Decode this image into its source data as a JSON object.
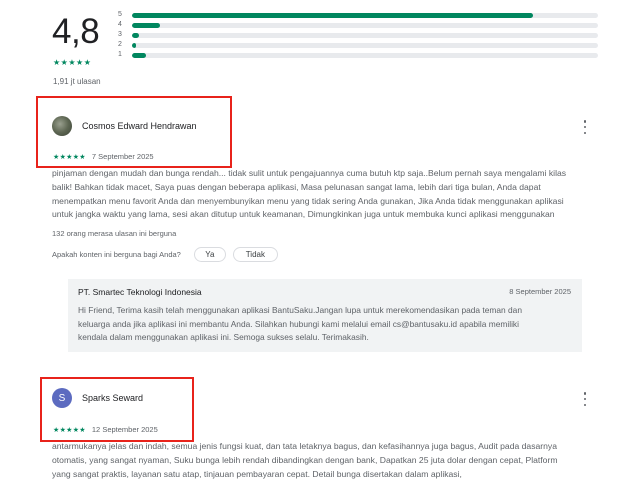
{
  "rating_summary": {
    "average": "4,8",
    "stars": "★★★★★",
    "review_count": "1,91 jt ulasan",
    "distribution": [
      {
        "label": "5",
        "fraction": 0.86
      },
      {
        "label": "4",
        "fraction": 0.06
      },
      {
        "label": "3",
        "fraction": 0.015
      },
      {
        "label": "2",
        "fraction": 0.008
      },
      {
        "label": "1",
        "fraction": 0.03
      }
    ],
    "accent_color": "#01875f"
  },
  "reviews": [
    {
      "name": "Cosmos Edward Hendrawan",
      "stars": "★★★★★",
      "date": "7 September 2025",
      "lines": [
        "pinjaman dengan mudah dan bunga rendah... tidak sulit untuk pengajuannya cuma butuh ktp saja..Belum pernah saya mengalami kilas",
        "balik! Bahkan tidak macet, Saya puas dengan beberapa aplikasi, Masa pelunasan sangat lama, lebih dari tiga bulan, Anda dapat",
        "menempatkan menu favorit Anda dan menyembunyikan menu yang tidak sering Anda gunakan, Jika Anda tidak menggunakan aplikasi",
        "untuk jangka waktu yang lama, sesi akan ditutup untuk keamanan, Dimungkinkan juga untuk membuka kunci aplikasi menggunakan"
      ],
      "helpful_count": "132 orang merasa ulasan ini berguna",
      "helpful_question": "Apakah konten ini berguna bagi Anda?",
      "yes_label": "Ya",
      "no_label": "Tidak",
      "developer_reply": {
        "name": "PT. Smartec Teknologi Indonesia",
        "date": "8 September 2025",
        "lines": [
          "Hi Friend, Terima kasih telah menggunakan aplikasi BantuSaku.Jangan lupa untuk merekomendasikan pada teman dan",
          "keluarga anda jika aplikasi ini membantu Anda. Silahkan hubungi kami melalui email cs@bantusaku.id apabila memiliki",
          "kendala dalam menggunakan aplikasi ini. Semoga sukses selalu. Terimakasih."
        ]
      }
    },
    {
      "name": "Sparks Seward",
      "avatar_letter": "S",
      "stars": "★★★★★",
      "date": "12 September 2025",
      "lines": [
        "antarmukanya jelas dan indah, semua jenis fungsi kuat, dan tata letaknya bagus, dan kefasihannya juga bagus, Audit pada dasarnya",
        "otomatis, yang sangat nyaman, Suku bunga lebih rendah dibandingkan dengan bank, Dapatkan 25 juta dolar dengan cepat, Platform",
        "yang sangat praktis, layanan satu atap, tinjauan pembayaran cepat. Detail bunga disertakan dalam aplikasi,"
      ]
    }
  ],
  "highlight_color": "#e8231b"
}
